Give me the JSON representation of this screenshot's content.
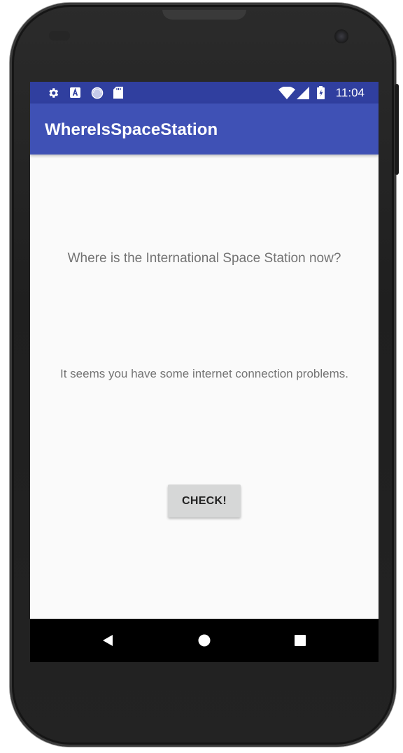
{
  "status_bar": {
    "time": "11:04",
    "icons": [
      "gear-icon",
      "a-badge-icon",
      "sync-circle-icon",
      "sd-card-icon",
      "wifi-icon",
      "cell-signal-icon",
      "battery-icon"
    ],
    "color": "#303f9f"
  },
  "app_bar": {
    "title": "WhereIsSpaceStation",
    "color": "#3f51b5"
  },
  "main": {
    "question": "Where is the International Space Station now?",
    "message": "It seems you have some internet connection problems.",
    "check_button_label": "CHECK!"
  },
  "nav_bar": {
    "items": [
      "back-icon",
      "home-icon",
      "recents-icon"
    ]
  }
}
